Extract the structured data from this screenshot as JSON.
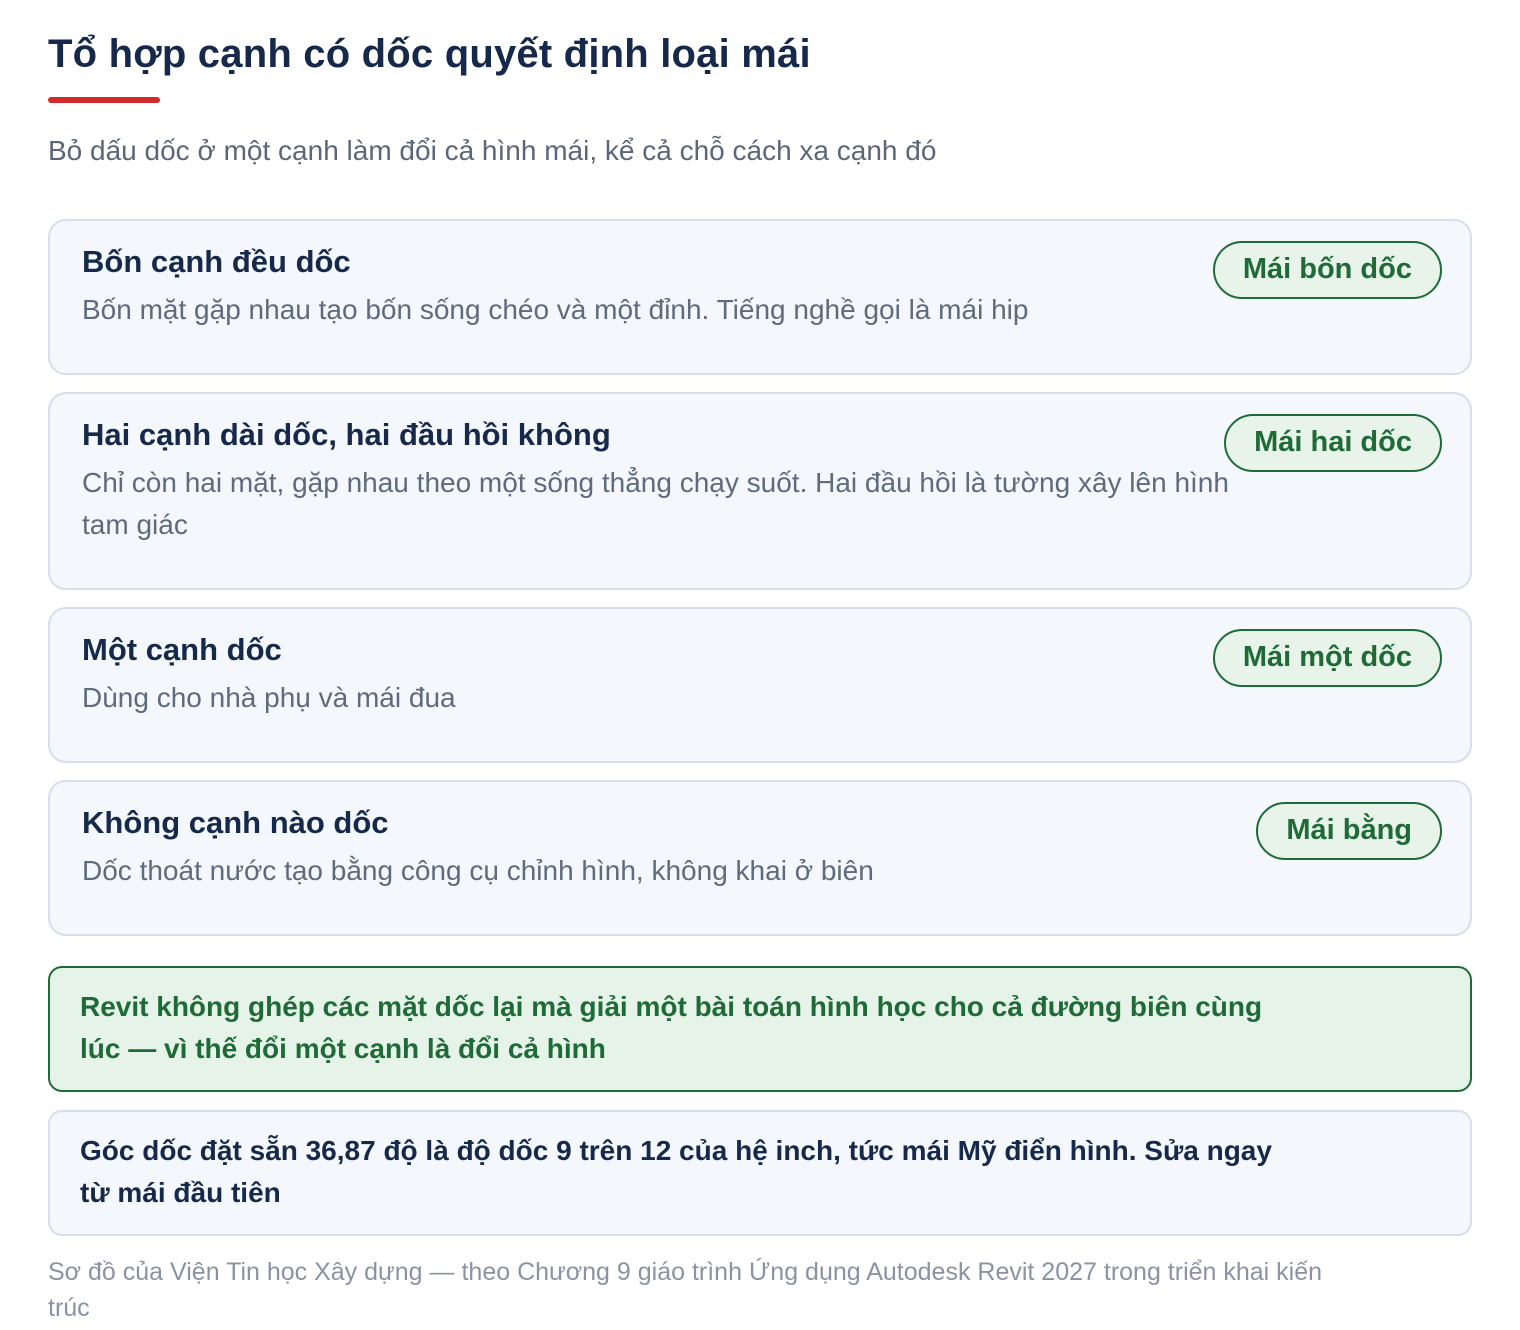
{
  "header": {
    "title": "Tổ hợp cạnh có dốc quyết định loại mái",
    "subtitle": "Bỏ dấu dốc ở một cạnh làm đổi cả hình mái, kể cả chỗ cách xa cạnh đó"
  },
  "cards": [
    {
      "title": "Bốn cạnh đều dốc",
      "desc": "Bốn mặt gặp nhau tạo bốn sống chéo và một đỉnh. Tiếng nghề gọi là mái hip",
      "badge": "Mái bốn dốc"
    },
    {
      "title": "Hai cạnh dài dốc, hai đầu hồi không",
      "desc": "Chỉ còn hai mặt, gặp nhau theo một sống thẳng chạy suốt. Hai đầu hồi là tường xây lên hình tam giác",
      "badge": "Mái hai dốc"
    },
    {
      "title": "Một cạnh dốc",
      "desc": "Dùng cho nhà phụ và mái đua",
      "badge": "Mái một dốc"
    },
    {
      "title": "Không cạnh nào dốc",
      "desc": "Dốc thoát nước tạo bằng công cụ chỉnh hình, không khai ở biên",
      "badge": "Mái bằng"
    }
  ],
  "notes": {
    "highlight": "Revit không ghép các mặt dốc lại mà giải một bài toán hình học cho cả đường biên cùng lúc — vì thế đổi một cạnh là đổi cả hình",
    "info": "Góc dốc đặt sẵn 36,87 độ là độ dốc 9 trên 12 của hệ inch, tức mái Mỹ điển hình. Sửa ngay từ mái đầu tiên"
  },
  "footer": "Sơ đồ của Viện Tin học Xây dựng — theo Chương 9 giáo trình Ứng dụng Autodesk Revit 2027 trong triển khai kiến trúc",
  "colors": {
    "accent_red": "#d12b2b",
    "badge_green": "#1e6b37",
    "card_bg": "#f4f7fc",
    "card_border": "#d5deea",
    "highlight_bg": "#e6f3e8",
    "heading_navy": "#16294a"
  }
}
